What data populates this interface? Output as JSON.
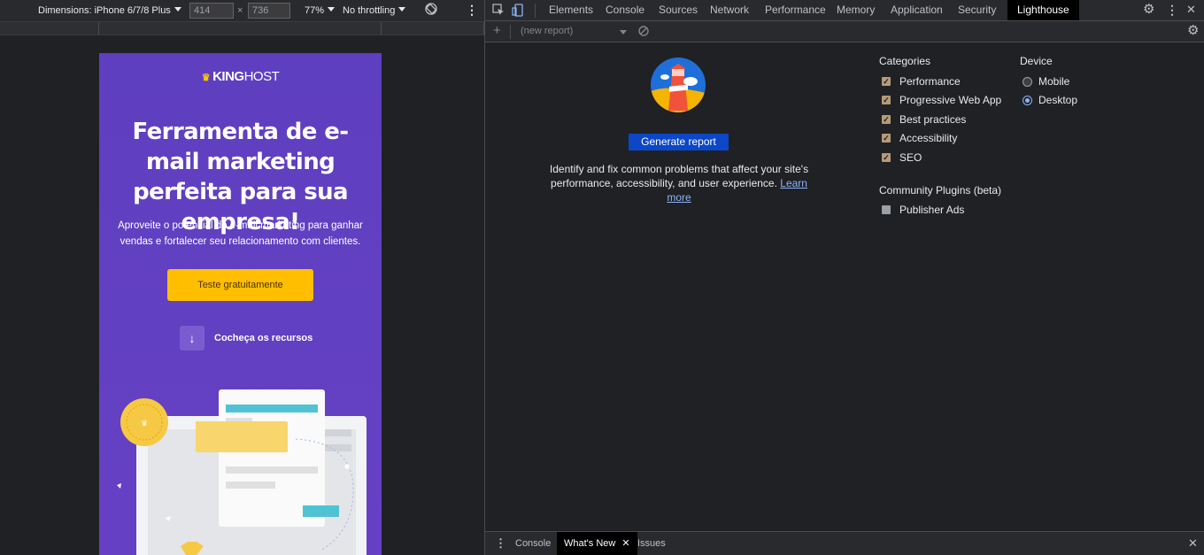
{
  "device_toolbar": {
    "dimensions_label": "Dimensions: iPhone 6/7/8 Plus",
    "width_value": "414",
    "times": "×",
    "height_value": "736",
    "zoom": "77%",
    "throttling": "No throttling"
  },
  "site": {
    "logo_bold": "KING",
    "logo_regular": "HOST",
    "hero_title": "Ferramenta de e-mail marketing perfeita para sua empresa!",
    "hero_subtitle": "Aproveite o potencial do e-mail marketing para ganhar vendas e fortalecer seu relacionamento com clientes.",
    "cta_label": "Teste gratuitamente",
    "features_label": "Cocheça os recursos",
    "colors": {
      "brand_purple": "#5f3dc4",
      "cta_yellow": "#ffbf00"
    }
  },
  "devtools": {
    "tabs": [
      {
        "label": "Elements"
      },
      {
        "label": "Console"
      },
      {
        "label": "Sources"
      },
      {
        "label": "Network"
      },
      {
        "label": "Performance"
      },
      {
        "label": "Memory"
      },
      {
        "label": "Application"
      },
      {
        "label": "Security"
      },
      {
        "label": "Lighthouse"
      }
    ],
    "active_tab": "Lighthouse",
    "report_select": "(new report)"
  },
  "lighthouse": {
    "generate_label": "Generate report",
    "description": "Identify and fix common problems that affect your site's performance, accessibility, and user experience.",
    "learn_more": "Learn more",
    "categories_title": "Categories",
    "categories": [
      {
        "label": "Performance",
        "checked": true
      },
      {
        "label": "Progressive Web App",
        "checked": true
      },
      {
        "label": "Best practices",
        "checked": true
      },
      {
        "label": "Accessibility",
        "checked": true
      },
      {
        "label": "SEO",
        "checked": true
      }
    ],
    "plugins_title": "Community Plugins (beta)",
    "plugins": [
      {
        "label": "Publisher Ads",
        "checked": false
      }
    ],
    "device_title": "Device",
    "devices": [
      {
        "label": "Mobile",
        "selected": false
      },
      {
        "label": "Desktop",
        "selected": true
      }
    ]
  },
  "drawer": {
    "tabs": [
      {
        "label": "Console"
      },
      {
        "label": "What's New"
      },
      {
        "label": "Issues"
      }
    ],
    "active_tab": "What's New"
  }
}
